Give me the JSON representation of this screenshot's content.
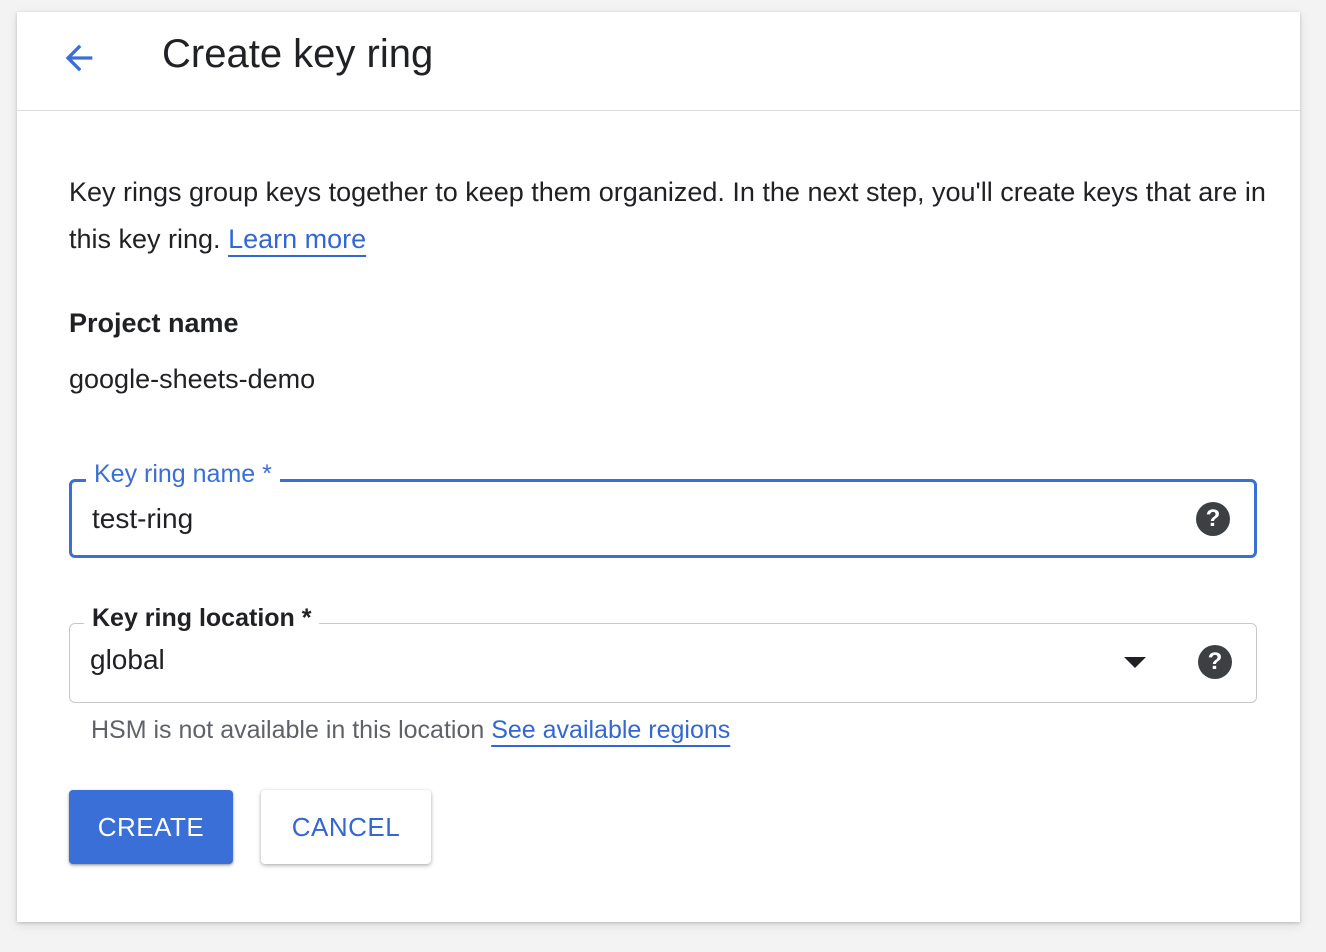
{
  "header": {
    "title": "Create key ring",
    "back_icon": "arrow-back-icon"
  },
  "intro": {
    "text": "Key rings group keys together to keep them organized. In the next step, you'll create keys that are in this key ring.",
    "learn_more": "Learn more"
  },
  "project": {
    "label": "Project name",
    "value": "google-sheets-demo"
  },
  "key_ring_name": {
    "label": "Key ring name *",
    "value": "test-ring",
    "help_icon": "help-icon"
  },
  "key_ring_location": {
    "label": "Key ring location *",
    "value": "global",
    "help_icon": "help-icon",
    "dropdown_icon": "dropdown-arrow-icon",
    "hint": "HSM is not available in this location",
    "hint_link": "See available regions"
  },
  "actions": {
    "create": "CREATE",
    "cancel": "CANCEL"
  },
  "colors": {
    "accent": "#3b6fd8",
    "link": "#3367d6",
    "text": "#202124",
    "secondary_text": "#5f6368"
  }
}
